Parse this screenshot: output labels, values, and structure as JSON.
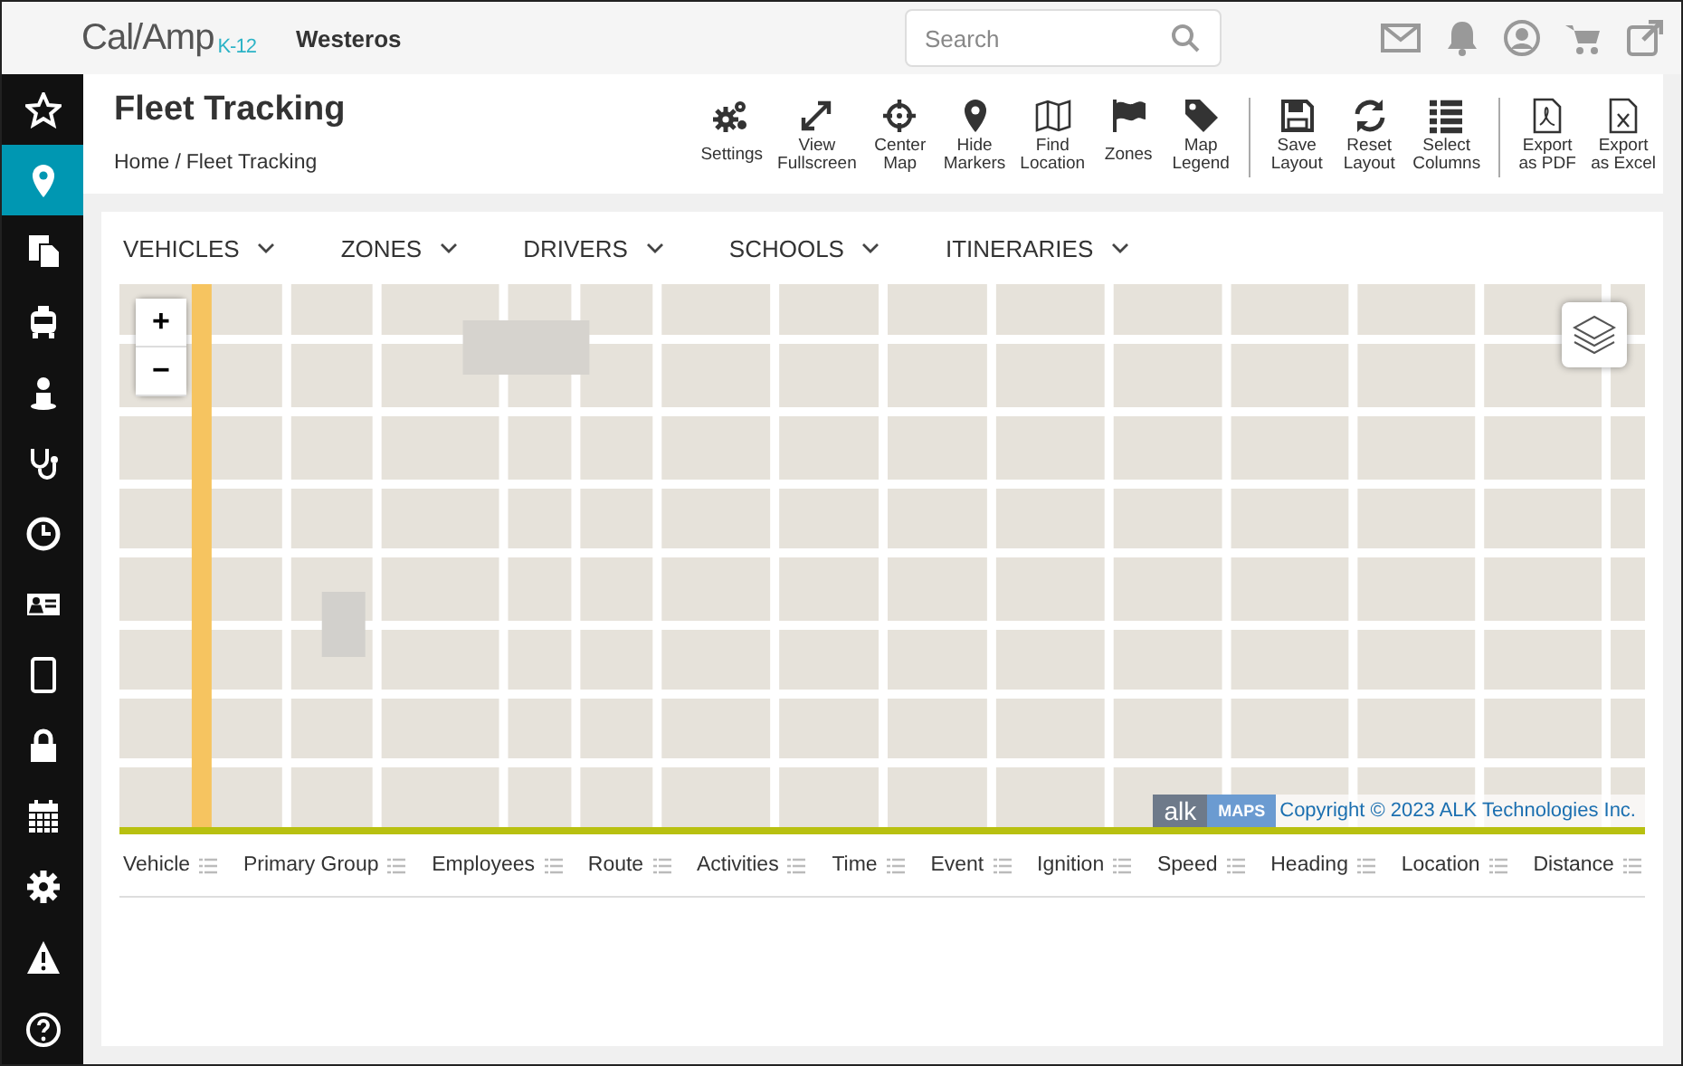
{
  "header": {
    "logo": "Cal/Amp",
    "logo_suffix": "K-12",
    "org": "Westeros",
    "search": {
      "placeholder": "Search"
    }
  },
  "sidebar": {
    "items": [
      {
        "selected": false
      },
      {
        "selected": true
      },
      {
        "selected": false
      },
      {
        "selected": false
      },
      {
        "selected": false
      },
      {
        "selected": false
      },
      {
        "selected": false
      },
      {
        "selected": false
      },
      {
        "selected": false
      },
      {
        "selected": false
      },
      {
        "selected": false
      },
      {
        "selected": false
      },
      {
        "selected": false
      },
      {
        "selected": false
      }
    ]
  },
  "page": {
    "title": "Fleet Tracking",
    "breadcrumb": {
      "items": [
        "Home",
        "Fleet Tracking"
      ],
      "separator": "/"
    }
  },
  "toolbar": {
    "groups": [
      {
        "buttons": [
          {
            "label": [
              "Settings"
            ]
          },
          {
            "label": [
              "View",
              "Fullscreen"
            ]
          },
          {
            "label": [
              "Center",
              "Map"
            ]
          },
          {
            "label": [
              "Hide",
              "Markers"
            ]
          },
          {
            "label": [
              "Find",
              "Location"
            ]
          },
          {
            "label": [
              "Zones"
            ]
          },
          {
            "label": [
              "Map",
              "Legend"
            ]
          }
        ]
      },
      {
        "buttons": [
          {
            "label": [
              "Save",
              "Layout"
            ]
          },
          {
            "label": [
              "Reset",
              "Layout"
            ]
          },
          {
            "label": [
              "Select",
              "Columns"
            ]
          }
        ]
      },
      {
        "buttons": [
          {
            "label": [
              "Export",
              "as PDF"
            ]
          },
          {
            "label": [
              "Export",
              "as Excel"
            ]
          }
        ]
      }
    ]
  },
  "tabs": [
    {
      "label": "VEHICLES"
    },
    {
      "label": "ZONES"
    },
    {
      "label": "DRIVERS"
    },
    {
      "label": "SCHOOLS"
    },
    {
      "label": "ITINERARIES"
    }
  ],
  "map": {
    "zoom_in": "+",
    "zoom_out": "−",
    "attribution": {
      "logo": "alk",
      "badge": "MAPS",
      "text": "Copyright © 2023 ALK Technologies Inc."
    }
  },
  "table": {
    "columns": [
      "Vehicle",
      "Primary Group",
      "Employees",
      "Route",
      "Activities",
      "Time",
      "Event",
      "Ignition",
      "Speed",
      "Heading",
      "Location",
      "Distance"
    ]
  }
}
